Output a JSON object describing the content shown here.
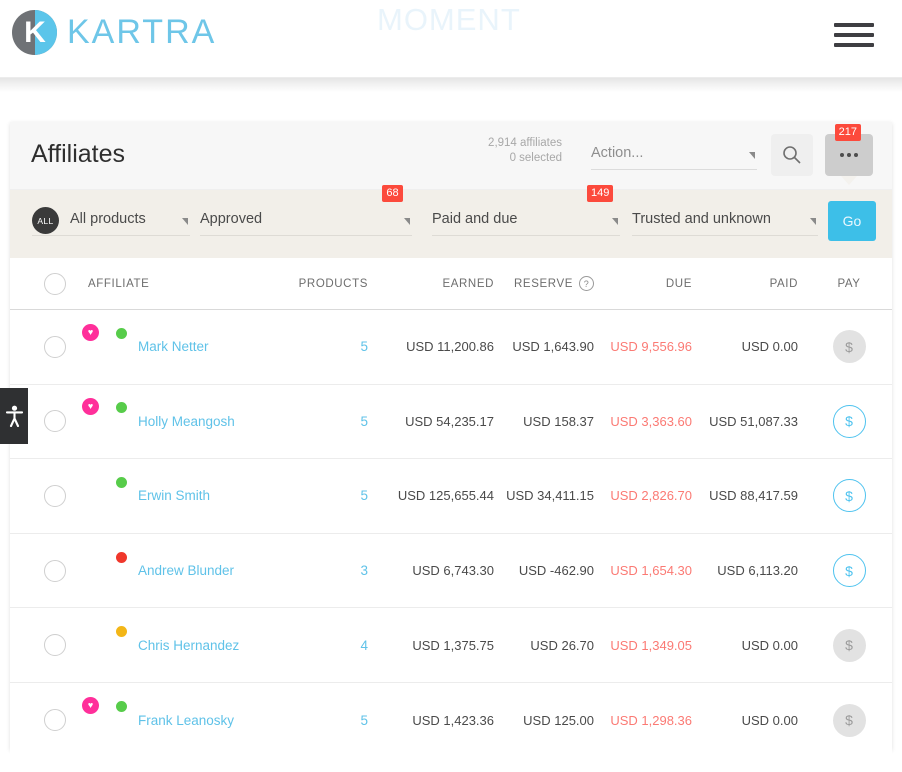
{
  "topnav": {
    "logo_text": "KARTRA",
    "logo_letter": "K",
    "ghost_text": "MOMENT",
    "menu_icon": "hamburger-icon",
    "logo_blue": "#6ec6e8",
    "logo_grey": "#6f7276"
  },
  "header": {
    "title": "Affiliates",
    "affiliates_count": "2,914 affiliates",
    "selected_count": "0 selected",
    "action_value": "Action...",
    "search_icon": "search-icon",
    "more_icon": "ellipsis-icon",
    "more_badge": "217",
    "badge_color": "#fc4a3c"
  },
  "filters": [
    {
      "chip": "ALL",
      "label": "All products",
      "badge": ""
    },
    {
      "chip": "",
      "label": "Approved",
      "badge": "68"
    },
    {
      "chip": "",
      "label": "Paid and due",
      "badge": "149"
    },
    {
      "chip": "",
      "label": "Trusted and unknown",
      "badge": ""
    }
  ],
  "go_button": {
    "label": "Go",
    "color": "#3dbfe8"
  },
  "table": {
    "columns": {
      "affiliate": "AFFILIATE",
      "products": "PRODUCTS",
      "earned": "EARNED",
      "reserve": "RESERVE",
      "due": "DUE",
      "paid": "PAID",
      "pay": "PAY"
    },
    "reserve_help_icon": "question-mark-icon",
    "rows": [
      {
        "name": "Mark Netter",
        "products": "5",
        "earned": "USD 11,200.86",
        "reserve": "USD 1,643.90",
        "due": "USD 9,556.96",
        "paid": "USD 0.00",
        "pay_label": "$",
        "pay_enabled": false,
        "heart": true,
        "status_color": "#57cc4a",
        "avatar_colors": [
          "#3f7fb0",
          "#e8c5a8"
        ]
      },
      {
        "name": "Holly Meangosh",
        "products": "5",
        "earned": "USD 54,235.17",
        "reserve": "USD 158.37",
        "due": "USD 3,363.60",
        "paid": "USD 51,087.33",
        "pay_label": "$",
        "pay_enabled": true,
        "heart": true,
        "status_color": "#57cc4a",
        "avatar_colors": [
          "#45b0ae",
          "#d6a184"
        ]
      },
      {
        "name": "Erwin Smith",
        "products": "5",
        "earned": "USD 125,655.44",
        "reserve": "USD 34,411.15",
        "due": "USD 2,826.70",
        "paid": "USD 88,417.59",
        "pay_label": "$",
        "pay_enabled": true,
        "heart": false,
        "status_color": "#57cc4a",
        "avatar_colors": [
          "#6b5642",
          "#c49a76"
        ]
      },
      {
        "name": "Andrew Blunder",
        "products": "3",
        "earned": "USD 6,743.30",
        "reserve": "USD -462.90",
        "due": "USD 1,654.30",
        "paid": "USD 6,113.20",
        "pay_label": "$",
        "pay_enabled": true,
        "heart": false,
        "status_color": "#f0372b",
        "avatar_colors": [
          "#2b2b2b",
          "#f0f0f0"
        ]
      },
      {
        "name": "Chris Hernandez",
        "products": "4",
        "earned": "USD 1,375.75",
        "reserve": "USD 26.70",
        "due": "USD 1,349.05",
        "paid": "USD 0.00",
        "pay_label": "$",
        "pay_enabled": false,
        "heart": false,
        "status_color": "#f3b617",
        "avatar_colors": [
          "#3a2f2a",
          "#c98f6b"
        ]
      },
      {
        "name": "Frank Leanosky",
        "products": "5",
        "earned": "USD 1,423.36",
        "reserve": "USD 125.00",
        "due": "USD 1,298.36",
        "paid": "USD 0.00",
        "pay_label": "$",
        "pay_enabled": false,
        "heart": true,
        "status_color": "#57cc4a",
        "avatar_colors": [
          "#5a5a5a",
          "#bdbdbd"
        ]
      }
    ]
  },
  "accessibility": {
    "icon": "accessibility-icon"
  }
}
